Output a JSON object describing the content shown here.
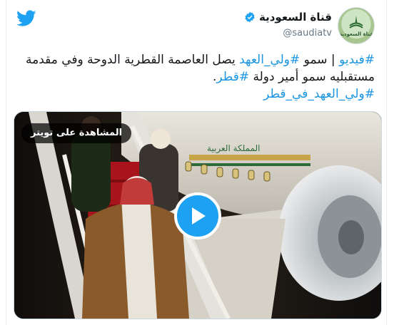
{
  "header": {
    "display_name": "قناة السعودية",
    "handle": "@saudiatv",
    "avatar_caption": "قناة السعودية"
  },
  "tweet": {
    "segments": [
      {
        "text": "#فيديو",
        "hashtag": true
      },
      {
        "text": " | سمو ",
        "hashtag": false
      },
      {
        "text": "#ولي_العهد",
        "hashtag": true
      },
      {
        "text": " يصل العاصمة القطرية الدوحة وفي مقدمة مستقبليه سمو أمير دولة ",
        "hashtag": false
      },
      {
        "text": "#قطر",
        "hashtag": true
      },
      {
        "text": ".",
        "hashtag": false
      },
      {
        "text": "\n",
        "hashtag": false
      },
      {
        "text": "#ولي_العهد_في_قطر",
        "hashtag": true
      }
    ]
  },
  "media": {
    "watch_label": "المشاهدة على تويتر",
    "aircraft_text": "المملكة العربية"
  },
  "colors": {
    "link": "#1b95e0",
    "twitter_blue": "#1da1f2",
    "text": "#14171a",
    "muted": "#657786"
  },
  "icons": {
    "brand": "twitter-bird-icon",
    "verified": "verified-badge-icon",
    "play": "play-icon"
  }
}
